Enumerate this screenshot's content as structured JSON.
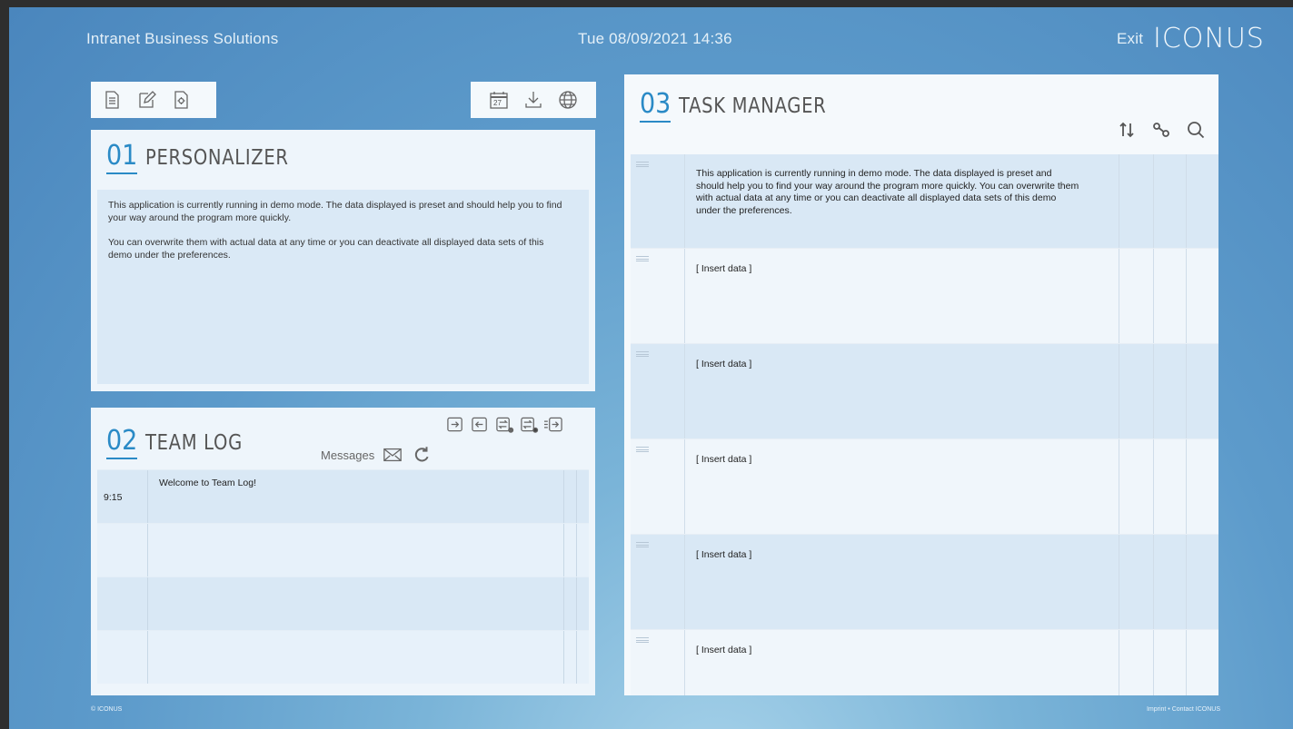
{
  "header": {
    "brand": "Intranet Business Solutions",
    "datetime": "Tue 08/09/2021  14:36",
    "exit_label": "Exit",
    "logo_text": "ICONUS"
  },
  "toolbar_left": {
    "icons": [
      "document-icon",
      "edit-icon",
      "settings-document-icon"
    ]
  },
  "toolbar_right": {
    "icons": [
      "calendar-icon",
      "download-icon",
      "globe-icon"
    ],
    "calendar_day": "27"
  },
  "personalizer": {
    "number": "01",
    "title": "PERSONALIZER",
    "para1": "This application is currently running in demo mode. The data displayed is preset and should help you to find your way around the program more quickly.",
    "para2": "You can overwrite them with actual data at any time or you can deactivate all displayed data sets of this demo under the preferences."
  },
  "teamlog": {
    "number": "02",
    "title": "TEAM LOG",
    "messages_label": "Messages",
    "rows": [
      {
        "time": "9:15",
        "message": "Welcome to Team Log!"
      },
      {
        "time": "",
        "message": ""
      },
      {
        "time": "",
        "message": ""
      },
      {
        "time": "",
        "message": ""
      }
    ]
  },
  "taskmanager": {
    "number": "03",
    "title": "TASK MANAGER",
    "intro": "This application is currently running in demo mode. The data displayed is preset and should help you to find your way around the program more quickly. You can overwrite them with actual data at any time or you can deactivate all displayed data sets of this demo under the preferences.",
    "rows": [
      "[ Insert data ]",
      "[ Insert data ]",
      "[ Insert data ]",
      "[ Insert data ]",
      "[ Insert data ]"
    ]
  },
  "footer": {
    "copyright": "© ICONUS",
    "links": "Imprint • Contact ICONUS"
  }
}
